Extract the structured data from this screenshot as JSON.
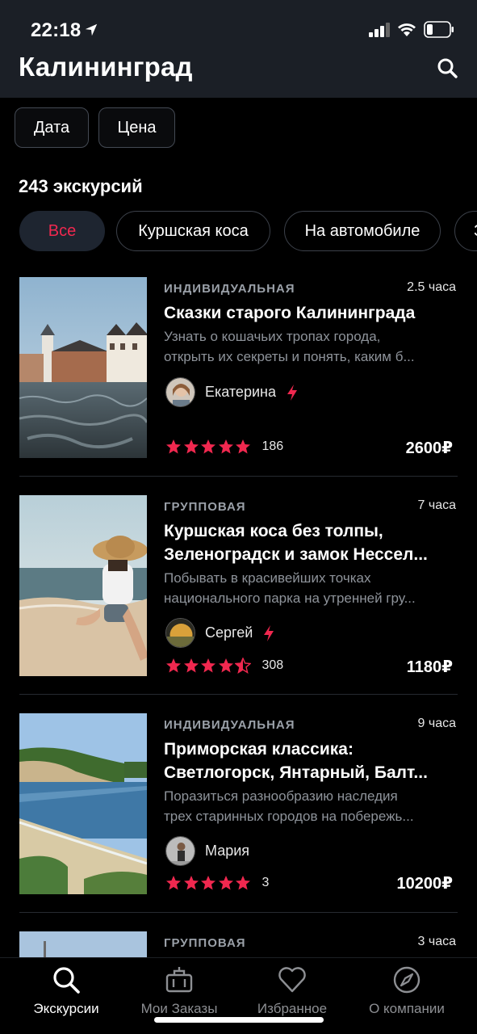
{
  "status_bar": {
    "time": "22:18"
  },
  "header": {
    "city": "Калининград"
  },
  "filters": {
    "date_label": "Дата",
    "price_label": "Цена"
  },
  "results": {
    "count_label": "243 экскурсий"
  },
  "categories": [
    "Все",
    "Куршская коса",
    "На автомобиле",
    "З"
  ],
  "tours": [
    {
      "type": "ИНДИВИДУАЛЬНАЯ",
      "duration": "2.5 часа",
      "title": "Сказки старого Калининграда",
      "description_line1": "Узнать о кошачьих тропах города,",
      "description_line2": "открыть их секреты и понять, каким б...",
      "guide": "Екатерина",
      "rating": 5,
      "reviews": "186",
      "price": "2600₽"
    },
    {
      "type": "ГРУППОВАЯ",
      "duration": "7 часа",
      "title_line1": "Куршская коса без толпы,",
      "title_line2": "Зеленоградск и замок Нессел...",
      "description_line1": "Побывать в красивейших точках",
      "description_line2": "национального парка на утренней гру...",
      "guide": "Сергей",
      "rating": 4.5,
      "reviews": "308",
      "price": "1180₽"
    },
    {
      "type": "ИНДИВИДУАЛЬНАЯ",
      "duration": "9 часа",
      "title_line1": "Приморская классика:",
      "title_line2": "Светлогорск, Янтарный, Балт...",
      "description_line1": "Поразиться разнообразию наследия",
      "description_line2": "трех старинных городов на побережь...",
      "guide": "Мария",
      "rating": 5,
      "reviews": "3",
      "price": "10200₽"
    },
    {
      "type": "ГРУППОВАЯ",
      "duration": "3 часа"
    }
  ],
  "bottom_nav": [
    {
      "label": "Экскурсии",
      "icon": "search-icon",
      "active": true
    },
    {
      "label": "Мои Заказы",
      "icon": "briefcase-icon",
      "active": false
    },
    {
      "label": "Избранное",
      "icon": "heart-icon",
      "active": false
    },
    {
      "label": "О компании",
      "icon": "compass-icon",
      "active": false
    }
  ],
  "colors": {
    "accent": "#f0284f",
    "header_bg": "#1b1f26",
    "background": "#000000",
    "muted_text": "#8e939a"
  }
}
